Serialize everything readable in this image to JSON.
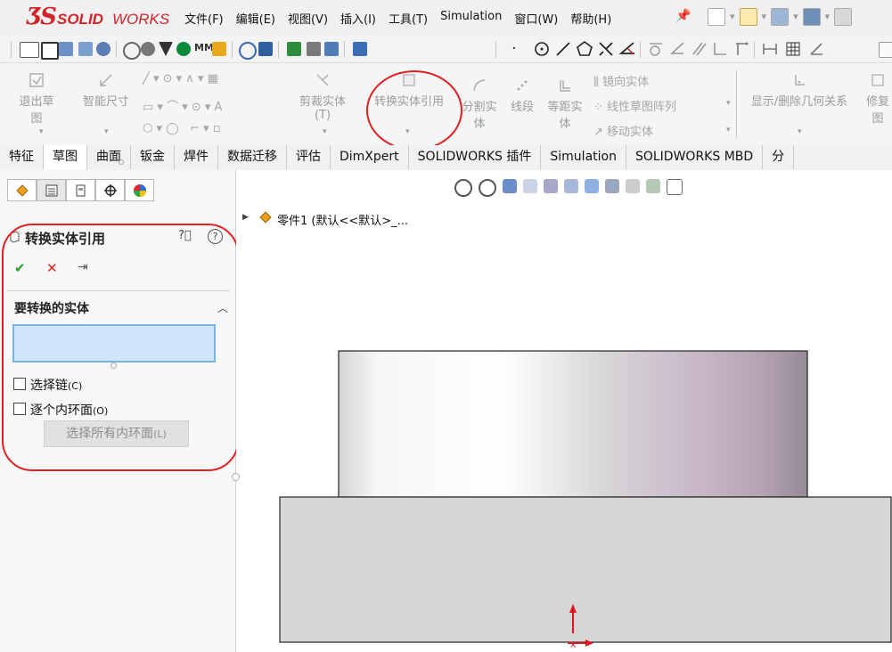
{
  "app": {
    "logo_ds": "ƷS",
    "logo_solid": "SOLID",
    "logo_works": "WORKS"
  },
  "menu": [
    "文件(F)",
    "编辑(E)",
    "视图(V)",
    "插入(I)",
    "工具(T)",
    "Simulation",
    "窗口(W)",
    "帮助(H)"
  ],
  "ribbon": {
    "exit_sketch": "退出草图",
    "smart_dim": "智能尺寸",
    "trim": "剪裁实体(T)",
    "convert": "转换实体引用",
    "split_1": "分割实",
    "split_2": "体",
    "line_seg": "线段",
    "offset_1": "等距实",
    "offset_2": "体",
    "mirror": "镜向实体",
    "linear_pattern": "线性草图阵列",
    "move": "移动实体",
    "show_relations": "显示/删除几何关系",
    "repair_1": "修复",
    "repair_2": "图"
  },
  "tabs": [
    "特征",
    "草图",
    "曲面",
    "钣金",
    "焊件",
    "数据迁移",
    "评估",
    "DimXpert",
    "SOLIDWORKS 插件",
    "Simulation",
    "SOLIDWORKS MBD",
    "分"
  ],
  "active_tab": "草图",
  "panel": {
    "title": "转换实体引用",
    "section_title": "要转换的实体",
    "select_chain": "选择链",
    "select_chain_key": "(C)",
    "each_inner_loop": "逐个内环面",
    "each_inner_loop_key": "(O)",
    "select_all_btn": "选择所有内环面",
    "select_all_key": "(L)"
  },
  "tree": {
    "label": "零件1 (默认<<默认>_..."
  },
  "colors": {
    "logo_red": "#d0242a",
    "selection_fill": "#cfe6fb",
    "annotation_red": "#e02020",
    "model_gray": "#d6d6d6"
  }
}
